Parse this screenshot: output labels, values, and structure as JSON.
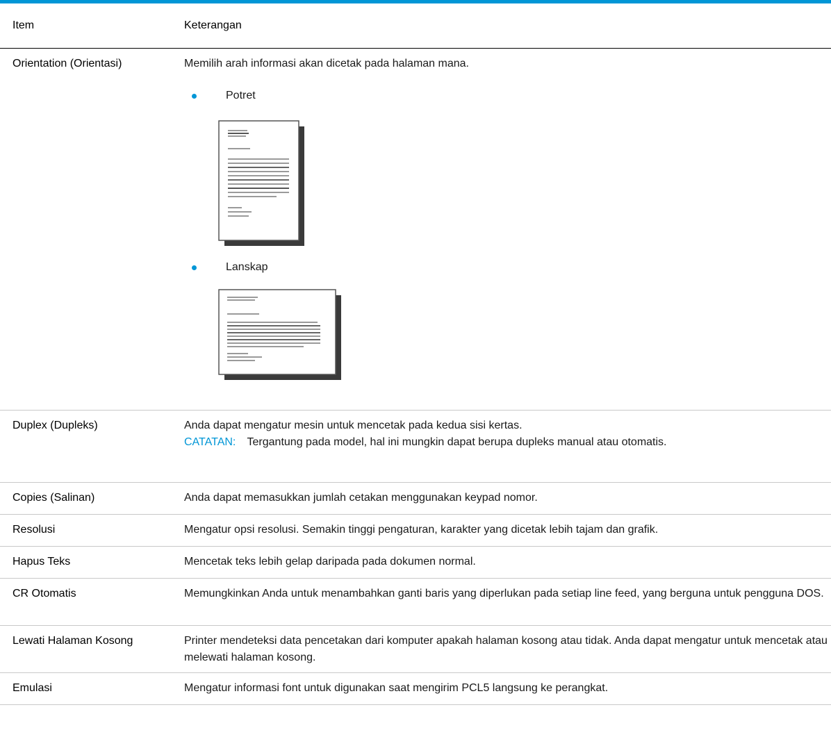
{
  "table": {
    "headers": {
      "item": "Item",
      "description": "Keterangan"
    },
    "rows": [
      {
        "item": "Orientation (Orientasi)",
        "description": "Memilih arah informasi akan dicetak pada halaman mana.",
        "options": [
          {
            "label": "Potret",
            "figure": "portrait-page-illustration"
          },
          {
            "label": "Lanskap",
            "figure": "landscape-page-illustration"
          }
        ]
      },
      {
        "item": "Duplex (Dupleks)",
        "description": "Anda dapat mengatur mesin untuk mencetak pada kedua sisi kertas.",
        "note": {
          "label": "CATATAN:",
          "text": "Tergantung pada model, hal ini mungkin dapat berupa dupleks manual atau otomatis."
        }
      },
      {
        "item": "Copies (Salinan)",
        "description": "Anda dapat memasukkan jumlah cetakan menggunakan keypad nomor."
      },
      {
        "item": "Resolusi",
        "description": "Mengatur opsi resolusi. Semakin tinggi pengaturan, karakter yang dicetak lebih tajam dan grafik."
      },
      {
        "item": "Hapus Teks",
        "description": "Mencetak teks lebih gelap daripada pada dokumen normal."
      },
      {
        "item": "CR Otomatis",
        "description": "Memungkinkan Anda untuk menambahkan ganti baris yang diperlukan pada setiap line feed, yang berguna untuk pengguna DOS."
      },
      {
        "item": "Lewati Halaman Kosong",
        "description": "Printer mendeteksi data pencetakan dari komputer apakah halaman kosong atau tidak. Anda dapat mengatur untuk mencetak atau melewati halaman kosong."
      },
      {
        "item": "Emulasi",
        "description": "Mengatur informasi font untuk digunakan saat mengirim PCL5 langsung ke perangkat."
      }
    ]
  },
  "colors": {
    "accent": "#0096d6",
    "rule": "#c8c8c8"
  },
  "icons": {
    "bullet": "bullet-dot-icon"
  }
}
